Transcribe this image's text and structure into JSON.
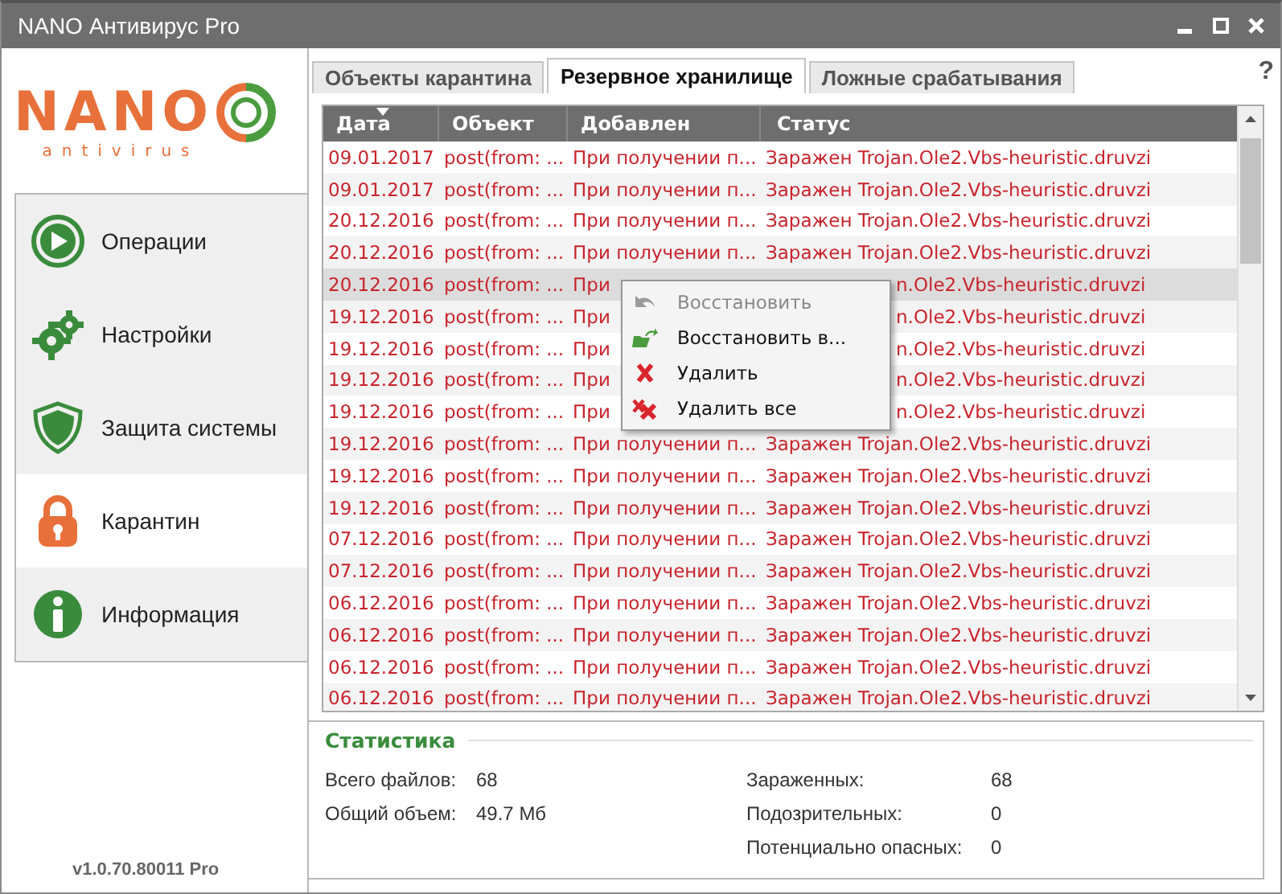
{
  "window": {
    "title": "NANO Антивирус Pro"
  },
  "logo": {
    "name": "NANO",
    "tagline": "antivirus"
  },
  "sidebar": {
    "items": [
      {
        "label": "Операции",
        "kind": "play",
        "selected": false
      },
      {
        "label": "Настройки",
        "kind": "gears",
        "selected": false
      },
      {
        "label": "Защита системы",
        "kind": "shield",
        "selected": false
      },
      {
        "label": "Карантин",
        "kind": "lock",
        "selected": true
      },
      {
        "label": "Информация",
        "kind": "info",
        "selected": false
      }
    ]
  },
  "version": "v1.0.70.80011 Pro",
  "tabs": [
    {
      "label": "Объекты карантина",
      "selected": false
    },
    {
      "label": "Резервное хранилище",
      "selected": true
    },
    {
      "label": "Ложные срабатывания",
      "selected": false
    }
  ],
  "help": "?",
  "table": {
    "columns": [
      "Дата",
      "Объект",
      "Добавлен",
      "Статус"
    ],
    "rows": [
      {
        "date": "09.01.2017",
        "object": "post(from: ...",
        "added": "При получении п...",
        "status": "Заражен Trojan.Ole2.Vbs-heuristic.druvzi",
        "selected": false
      },
      {
        "date": "09.01.2017",
        "object": "post(from: ...",
        "added": "При получении п...",
        "status": "Заражен Trojan.Ole2.Vbs-heuristic.druvzi",
        "selected": false
      },
      {
        "date": "20.12.2016",
        "object": "post(from: ...",
        "added": "При получении п...",
        "status": "Заражен Trojan.Ole2.Vbs-heuristic.druvzi",
        "selected": false
      },
      {
        "date": "20.12.2016",
        "object": "post(from: ...",
        "added": "При получении п...",
        "status": "Заражен Trojan.Ole2.Vbs-heuristic.druvzi",
        "selected": false
      },
      {
        "date": "20.12.2016",
        "object": "post(from: ...",
        "added": "При",
        "status": "n.Ole2.Vbs-heuristic.druvzi",
        "selected": true
      },
      {
        "date": "19.12.2016",
        "object": "post(from: ...",
        "added": "При",
        "status": "n.Ole2.Vbs-heuristic.druvzi",
        "selected": false
      },
      {
        "date": "19.12.2016",
        "object": "post(from: ...",
        "added": "При",
        "status": "n.Ole2.Vbs-heuristic.druvzi",
        "selected": false
      },
      {
        "date": "19.12.2016",
        "object": "post(from: ...",
        "added": "При",
        "status": "n.Ole2.Vbs-heuristic.druvzi",
        "selected": false
      },
      {
        "date": "19.12.2016",
        "object": "post(from: ...",
        "added": "При",
        "status": "n.Ole2.Vbs-heuristic.druvzi",
        "selected": false
      },
      {
        "date": "19.12.2016",
        "object": "post(from: ...",
        "added": "При получении п...",
        "status": "Заражен Trojan.Ole2.Vbs-heuristic.druvzi",
        "selected": false
      },
      {
        "date": "19.12.2016",
        "object": "post(from: ...",
        "added": "При получении п...",
        "status": "Заражен Trojan.Ole2.Vbs-heuristic.druvzi",
        "selected": false
      },
      {
        "date": "19.12.2016",
        "object": "post(from: ...",
        "added": "При получении п...",
        "status": "Заражен Trojan.Ole2.Vbs-heuristic.druvzi",
        "selected": false
      },
      {
        "date": "07.12.2016",
        "object": "post(from: ...",
        "added": "При получении п...",
        "status": "Заражен Trojan.Ole2.Vbs-heuristic.druvzi",
        "selected": false
      },
      {
        "date": "07.12.2016",
        "object": "post(from: ...",
        "added": "При получении п...",
        "status": "Заражен Trojan.Ole2.Vbs-heuristic.druvzi",
        "selected": false
      },
      {
        "date": "06.12.2016",
        "object": "post(from: ...",
        "added": "При получении п...",
        "status": "Заражен Trojan.Ole2.Vbs-heuristic.druvzi",
        "selected": false
      },
      {
        "date": "06.12.2016",
        "object": "post(from: ...",
        "added": "При получении п...",
        "status": "Заражен Trojan.Ole2.Vbs-heuristic.druvzi",
        "selected": false
      },
      {
        "date": "06.12.2016",
        "object": "post(from: ...",
        "added": "При получении п...",
        "status": "Заражен Trojan.Ole2.Vbs-heuristic.druvzi",
        "selected": false
      },
      {
        "date": "06.12.2016",
        "object": "post(from: ...",
        "added": "При получении п...",
        "status": "Заражен Trojan.Ole2.Vbs-heuristic.druvzi",
        "selected": false
      }
    ]
  },
  "context_menu": {
    "items": [
      {
        "label": "Восстановить",
        "kind": "restore",
        "disabled": true
      },
      {
        "label": "Восстановить в...",
        "kind": "restore-to",
        "disabled": false
      },
      {
        "label": "Удалить",
        "kind": "delete",
        "disabled": false
      },
      {
        "label": "Удалить все",
        "kind": "delete-all",
        "disabled": false
      }
    ]
  },
  "statistics": {
    "title": "Статистика",
    "left": [
      {
        "label": "Всего файлов:",
        "value": "68"
      },
      {
        "label": "Общий объем:",
        "value": "49.7 Мб"
      }
    ],
    "right": [
      {
        "label": "Зараженных:",
        "value": "68"
      },
      {
        "label": "Подозрительных:",
        "value": "0"
      },
      {
        "label": "Потенциально опасных:",
        "value": "0"
      }
    ]
  }
}
